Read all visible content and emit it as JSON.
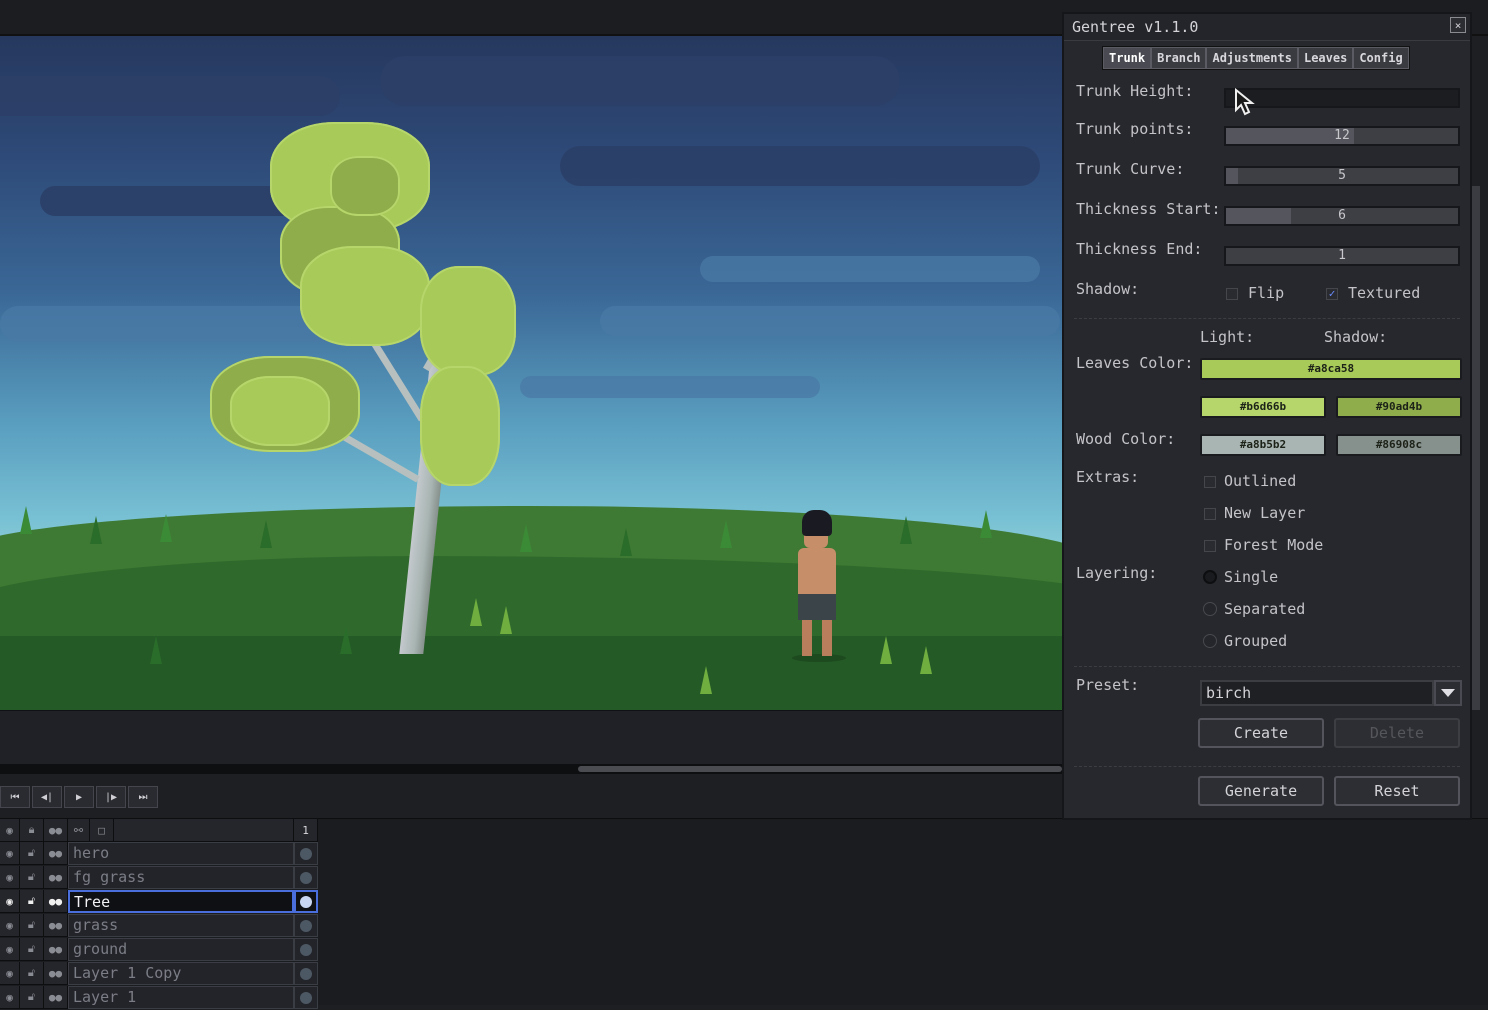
{
  "dialog": {
    "title": "Gentree v1.1.0",
    "close_label": "×",
    "tabs": [
      "Trunk",
      "Branch",
      "Adjustments",
      "Leaves",
      "Config"
    ],
    "active_tab": "Trunk",
    "fields": {
      "trunk_height": {
        "label": "Trunk Height:",
        "value": ""
      },
      "trunk_points": {
        "label": "Trunk points:",
        "value": "12",
        "level": 0.55
      },
      "trunk_curve": {
        "label": "Trunk Curve:",
        "value": "5",
        "level": 0.05
      },
      "thickness_start": {
        "label": "Thickness Start:",
        "value": "6",
        "level": 0.28
      },
      "thickness_end": {
        "label": "Thickness End:",
        "value": "1",
        "level": 0.0
      }
    },
    "shadow": {
      "label": "Shadow:",
      "flip": "Flip",
      "flip_checked": false,
      "textured": "Textured",
      "textured_checked": true
    },
    "colors": {
      "light_header": "Light:",
      "shadow_header": "Shadow:",
      "leaves_label": "Leaves Color:",
      "leaves_main": "#a8ca58",
      "leaves_light": "#b6d66b",
      "leaves_shadow": "#90ad4b",
      "wood_label": "Wood Color:",
      "wood_light": "#a8b5b2",
      "wood_shadow": "#86908c"
    },
    "extras": {
      "label": "Extras:",
      "items": [
        "Outlined",
        "New Layer",
        "Forest Mode"
      ]
    },
    "layering": {
      "label": "Layering:",
      "options": [
        "Single",
        "Separated",
        "Grouped"
      ],
      "selected": "Single"
    },
    "preset": {
      "label": "Preset:",
      "value": "birch"
    },
    "buttons": {
      "create": "Create",
      "delete": "Delete",
      "generate": "Generate",
      "reset": "Reset"
    }
  },
  "timeline": {
    "frame_header": "1",
    "layers": [
      {
        "name": "hero",
        "selected": false
      },
      {
        "name": "fg grass",
        "selected": false
      },
      {
        "name": "Tree",
        "selected": true
      },
      {
        "name": "grass",
        "selected": false
      },
      {
        "name": "ground",
        "selected": false
      },
      {
        "name": "Layer 1 Copy",
        "selected": false
      },
      {
        "name": "Layer 1",
        "selected": false
      }
    ]
  },
  "playback": {
    "icons": [
      "first-frame-icon",
      "prev-frame-icon",
      "play-icon",
      "next-frame-icon",
      "last-frame-icon"
    ]
  }
}
